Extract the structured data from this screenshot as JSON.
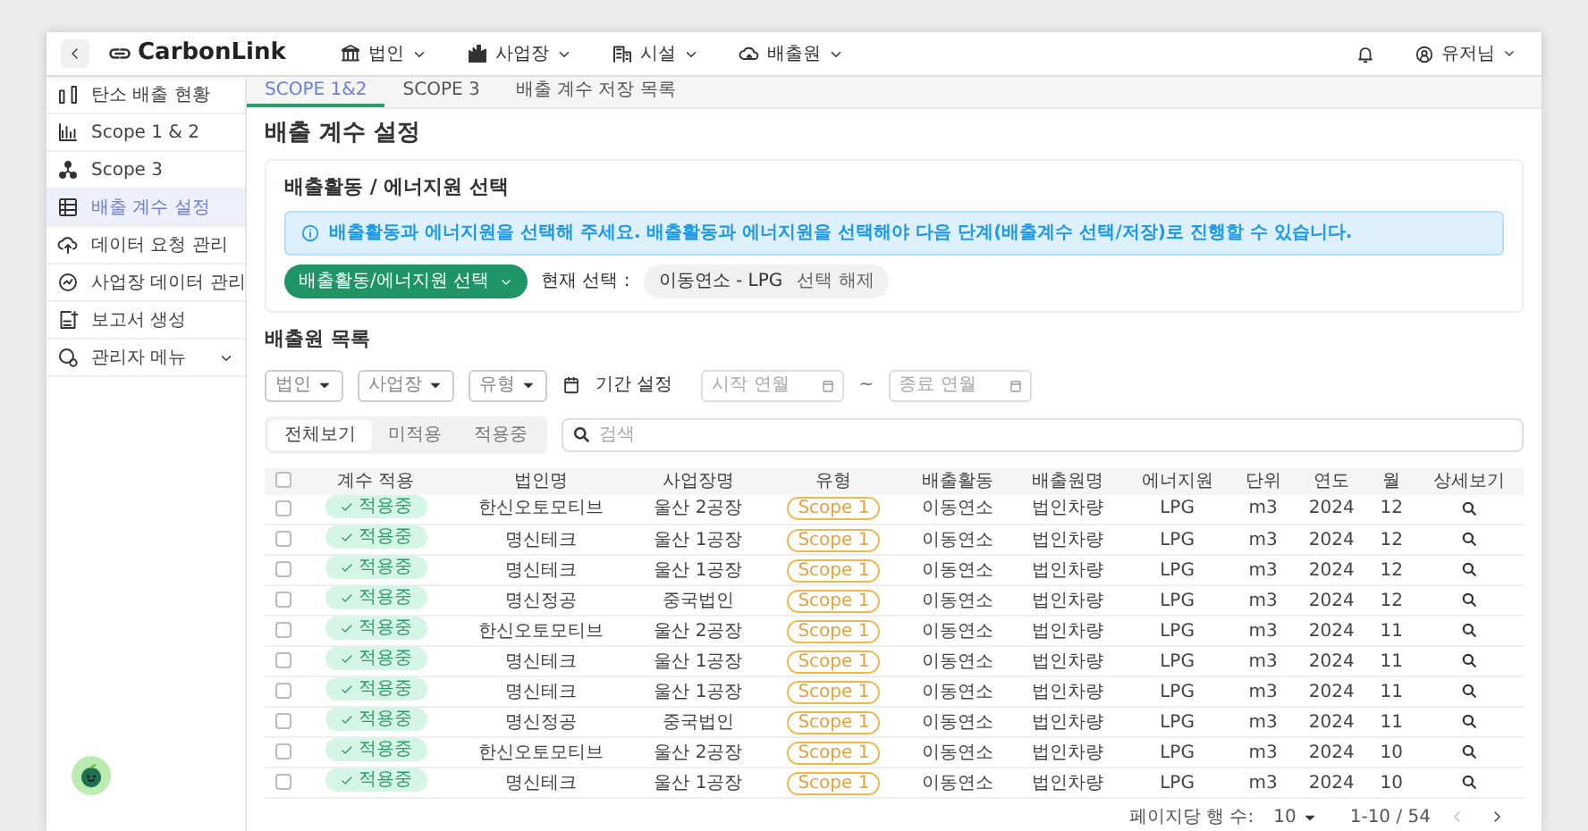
{
  "topbar": {
    "logo": "CarbonLink",
    "menus": [
      {
        "label": "법인"
      },
      {
        "label": "사업장"
      },
      {
        "label": "시설"
      },
      {
        "label": "배출원"
      }
    ],
    "user": "유저님"
  },
  "sidebar": {
    "items": [
      {
        "label": "탄소 배출 현황",
        "kind": "link",
        "selected": false
      },
      {
        "label": "Scope 1 & 2",
        "kind": "link",
        "selected": false
      },
      {
        "label": "Scope 3",
        "kind": "link",
        "selected": false
      },
      {
        "label": "배출 계수 설정",
        "kind": "link",
        "selected": true
      },
      {
        "label": "데이터 요청 관리",
        "kind": "link",
        "selected": false
      },
      {
        "label": "사업장 데이터 관리",
        "kind": "link",
        "selected": false
      },
      {
        "label": "보고서 생성",
        "kind": "link",
        "selected": false
      },
      {
        "label": "관리자 메뉴",
        "kind": "submenu",
        "selected": false
      }
    ]
  },
  "tabs": [
    {
      "label": "SCOPE 1&2",
      "selected": true
    },
    {
      "label": "SCOPE 3",
      "selected": false
    },
    {
      "label": "배출 계수 저장 목록",
      "selected": false
    }
  ],
  "page_title": "배출 계수 설정",
  "selection_card": {
    "title": "배출활동 / 에너지원 선택",
    "alert": "배출활동과 에너지원을 선택해 주세요. 배출활동과 에너지원을 선택해야 다음 단계(배출계수 선택/저장)로 진행할 수 있습니다.",
    "button": "배출활동/에너지원 선택",
    "current_label": "현재 선택 :",
    "chip": {
      "value": "이동연소 - LPG",
      "clear": "선택 해제"
    }
  },
  "source_list": {
    "title": "배출원 목록",
    "filters": [
      {
        "label": "법인"
      },
      {
        "label": "사업장"
      },
      {
        "label": "유형"
      }
    ],
    "period_label": "기간 설정",
    "start_placeholder": "시작 연월",
    "separator": "~",
    "end_placeholder": "종료 연월",
    "view_tabs": [
      {
        "label": "전체보기",
        "selected": true
      },
      {
        "label": "미적용",
        "selected": false
      },
      {
        "label": "적용중",
        "selected": false
      }
    ],
    "search_placeholder": "검색",
    "header_checked": false,
    "columns": [
      "계수 적용",
      "법인명",
      "사업장명",
      "유형",
      "배출활동",
      "배출원명",
      "에너지원",
      "단위",
      "연도",
      "월",
      "상세보기"
    ],
    "rows": [
      {
        "checked": false,
        "status": "적용중",
        "corp": "한신오토모티브",
        "site": "울산 2공장",
        "type": "Scope 1",
        "activity": "이동연소",
        "source": "법인차량",
        "energy": "LPG",
        "unit": "m3",
        "year": "2024",
        "month": "12"
      },
      {
        "checked": false,
        "status": "적용중",
        "corp": "명신테크",
        "site": "울산 1공장",
        "type": "Scope 1",
        "activity": "이동연소",
        "source": "법인차량",
        "energy": "LPG",
        "unit": "m3",
        "year": "2024",
        "month": "12"
      },
      {
        "checked": false,
        "status": "적용중",
        "corp": "명신테크",
        "site": "울산 1공장",
        "type": "Scope 1",
        "activity": "이동연소",
        "source": "법인차량",
        "energy": "LPG",
        "unit": "m3",
        "year": "2024",
        "month": "12"
      },
      {
        "checked": false,
        "status": "적용중",
        "corp": "명신정공",
        "site": "중국법인",
        "type": "Scope 1",
        "activity": "이동연소",
        "source": "법인차량",
        "energy": "LPG",
        "unit": "m3",
        "year": "2024",
        "month": "12"
      },
      {
        "checked": false,
        "status": "적용중",
        "corp": "한신오토모티브",
        "site": "울산 2공장",
        "type": "Scope 1",
        "activity": "이동연소",
        "source": "법인차량",
        "energy": "LPG",
        "unit": "m3",
        "year": "2024",
        "month": "11"
      },
      {
        "checked": false,
        "status": "적용중",
        "corp": "명신테크",
        "site": "울산 1공장",
        "type": "Scope 1",
        "activity": "이동연소",
        "source": "법인차량",
        "energy": "LPG",
        "unit": "m3",
        "year": "2024",
        "month": "11"
      },
      {
        "checked": false,
        "status": "적용중",
        "corp": "명신테크",
        "site": "울산 1공장",
        "type": "Scope 1",
        "activity": "이동연소",
        "source": "법인차량",
        "energy": "LPG",
        "unit": "m3",
        "year": "2024",
        "month": "11"
      },
      {
        "checked": false,
        "status": "적용중",
        "corp": "명신정공",
        "site": "중국법인",
        "type": "Scope 1",
        "activity": "이동연소",
        "source": "법인차량",
        "energy": "LPG",
        "unit": "m3",
        "year": "2024",
        "month": "11"
      },
      {
        "checked": false,
        "status": "적용중",
        "corp": "한신오토모티브",
        "site": "울산 2공장",
        "type": "Scope 1",
        "activity": "이동연소",
        "source": "법인차량",
        "energy": "LPG",
        "unit": "m3",
        "year": "2024",
        "month": "10"
      },
      {
        "checked": false,
        "status": "적용중",
        "corp": "명신테크",
        "site": "울산 1공장",
        "type": "Scope 1",
        "activity": "이동연소",
        "source": "법인차량",
        "energy": "LPG",
        "unit": "m3",
        "year": "2024",
        "month": "10"
      }
    ],
    "pagination": {
      "rows_label": "페이지당 행 수:",
      "rows_value": "10",
      "range": "1-10 / 54"
    }
  }
}
